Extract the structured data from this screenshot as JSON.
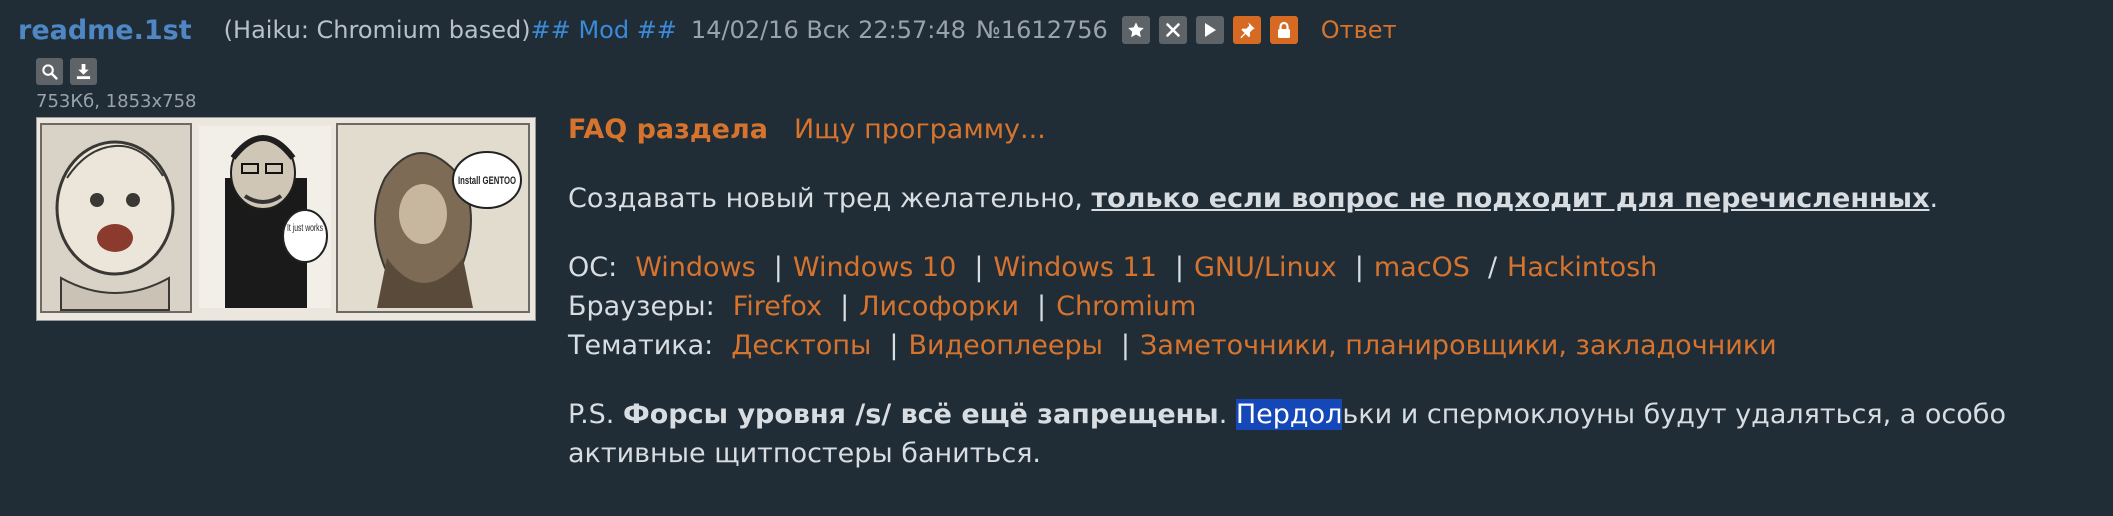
{
  "header": {
    "title": "readme.1st",
    "name": "(Haiku: Chromium based)",
    "mod": "## Mod ##",
    "date": "14/02/16 Вск 22:57:48",
    "post_number": "№1612756",
    "reply": "Ответ"
  },
  "file": {
    "info": "753Кб, 1853x758",
    "cartoon_texts": [
      "Install GENTOO",
      "It just works"
    ]
  },
  "post": {
    "faq_link": "FAQ раздела",
    "search_link": "Ищу программу...",
    "intro_text": "Создавать новый тред желательно, ",
    "intro_bold": "только если вопрос не подходит для перечисленных",
    "intro_end": ".",
    "os": {
      "label": "ОС:",
      "links": [
        "Windows",
        "Windows 10",
        "Windows 11",
        "GNU/Linux",
        "macOS",
        "Hackintosh"
      ],
      "separators": [
        "|",
        "|",
        "|",
        "|",
        "/"
      ]
    },
    "browsers": {
      "label": "Браузеры:",
      "links": [
        "Firefox",
        "Лисофорки",
        "Chromium"
      ],
      "separators": [
        "|",
        "|"
      ]
    },
    "topics": {
      "label": "Тематика:",
      "links": [
        "Десктопы",
        "Видеоплееры",
        "Заметочники, планировщики, закладочники"
      ],
      "separators": [
        "|",
        "|"
      ]
    },
    "ps_prefix": "P.S. ",
    "ps_bold": "Форсы уровня /s/ всё ещё запрещены",
    "ps_dot": ". ",
    "ps_selected": "Пердол",
    "ps_rest": "ьки и спермоклоуны будут удаляться, а особо активные щитпостеры баниться."
  },
  "colors": {
    "background": "#202c36",
    "link": "#d6742e",
    "title": "#4f87c4",
    "selection": "#1447b8"
  }
}
